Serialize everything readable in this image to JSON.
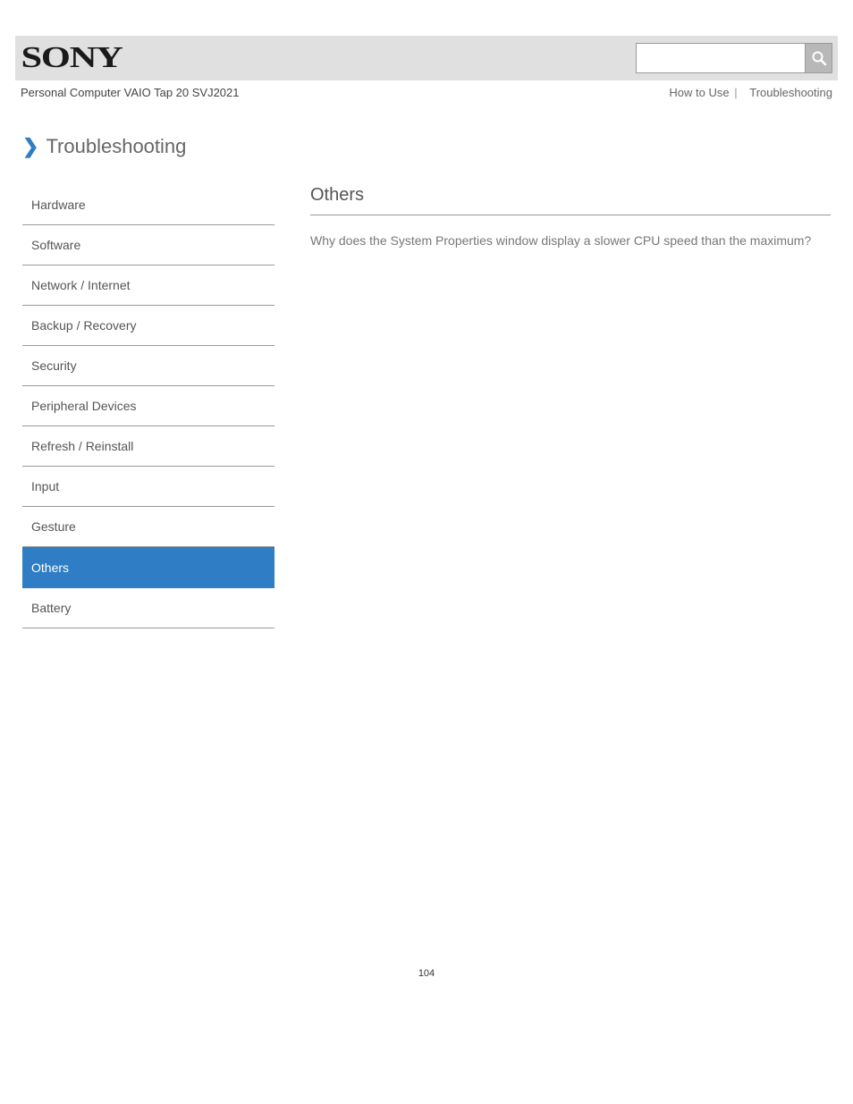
{
  "header": {
    "brand": "SONY",
    "user_guide": "Personal Computer  VAIO Tap 20 SVJ2021",
    "links": {
      "howto": "How to Use",
      "tshoot": "Troubleshooting"
    },
    "search_placeholder": ""
  },
  "title": "Troubleshooting",
  "sidebar": {
    "items": [
      {
        "label": "Hardware"
      },
      {
        "label": "Software"
      },
      {
        "label": "Network / Internet"
      },
      {
        "label": "Backup / Recovery"
      },
      {
        "label": "Security"
      },
      {
        "label": "Peripheral Devices"
      },
      {
        "label": "Refresh / Reinstall"
      },
      {
        "label": "Input"
      },
      {
        "label": "Gesture"
      },
      {
        "label": "Others"
      },
      {
        "label": "Battery"
      }
    ],
    "active_index": 9
  },
  "main": {
    "heading": "Others",
    "links": [
      "Why does the System Properties window display a slower CPU speed than the maximum?"
    ]
  },
  "page_number": "104"
}
